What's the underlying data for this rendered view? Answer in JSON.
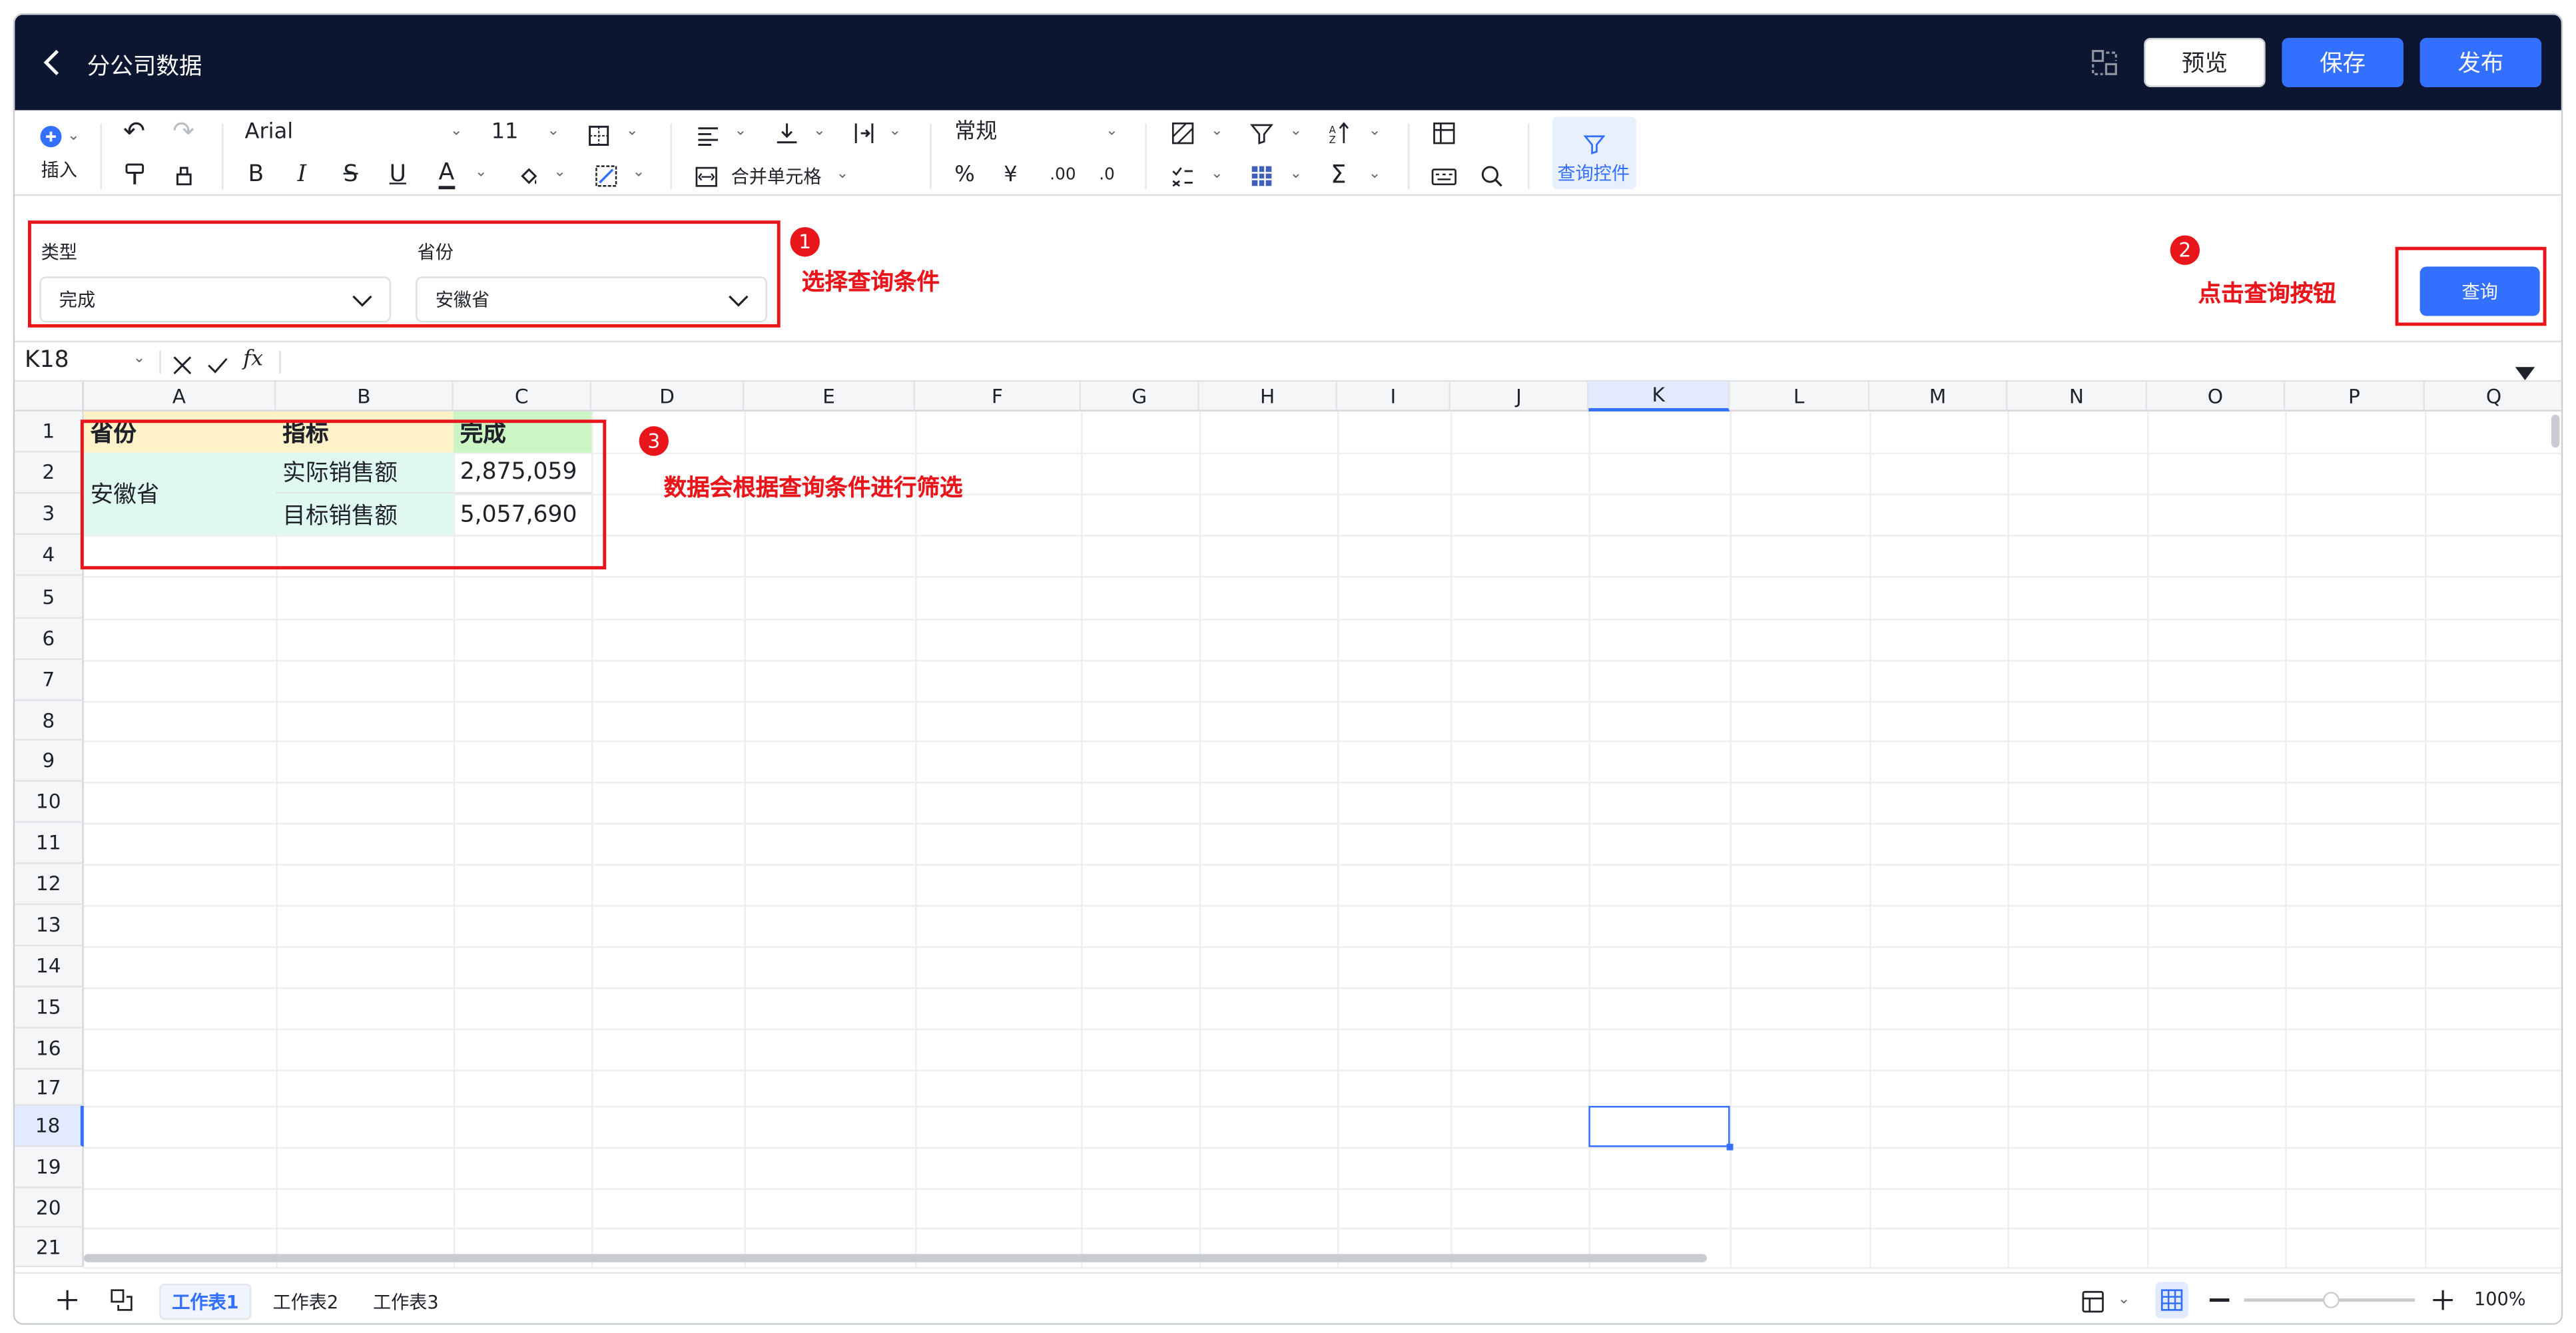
{
  "header": {
    "title": "分公司数据",
    "preview_label": "预览",
    "save_label": "保存",
    "publish_label": "发布"
  },
  "toolbar": {
    "insert_label": "插入",
    "font": "Arial",
    "font_size": "11",
    "merge_label": "合并单元格",
    "number_format": "常规",
    "query_control_label": "查询控件"
  },
  "query": {
    "type_label": "类型",
    "type_value": "完成",
    "province_label": "省份",
    "province_value": "安徽省",
    "button_label": "查询"
  },
  "annotations": {
    "a1_num": "1",
    "a1_text": "选择查询条件",
    "a2_num": "2",
    "a2_text": "点击查询按钮",
    "a3_num": "3",
    "a3_text": "数据会根据查询条件进行筛选"
  },
  "formula_bar": {
    "cell_ref": "K18",
    "fx": "fx"
  },
  "grid": {
    "columns": [
      "A",
      "B",
      "C",
      "D",
      "E",
      "F",
      "G",
      "H",
      "I",
      "J",
      "K",
      "L",
      "M",
      "N",
      "O",
      "P",
      "Q"
    ],
    "rows": [
      "1",
      "2",
      "3",
      "4",
      "5",
      "6",
      "7",
      "8",
      "9",
      "10",
      "11",
      "12",
      "13",
      "14",
      "15",
      "16",
      "17",
      "18",
      "19",
      "20",
      "21"
    ],
    "selected_cell": "K18",
    "cells": {
      "a1": "省份",
      "b1": "指标",
      "c1": "完成",
      "a2": "安徽省",
      "b2": "实际销售额",
      "c2": "2,875,059",
      "b3": "目标销售额",
      "c3": "5,057,690"
    },
    "colors": {
      "header_fill": "#fff2c9",
      "header_done_fill": "#cbf6c4",
      "body_fill": "#dff9f1"
    }
  },
  "sheets": [
    "工作表1",
    "工作表2",
    "工作表3"
  ],
  "active_sheet": "工作表1",
  "zoom": "100%",
  "accent_color": "#3370ff",
  "annotation_color": "#e8161b"
}
